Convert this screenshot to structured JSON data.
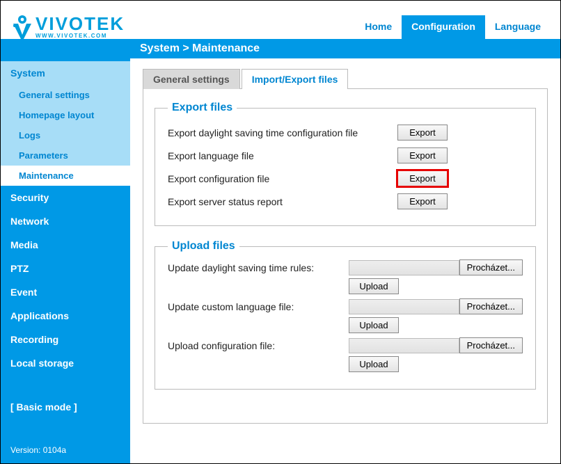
{
  "logo": {
    "text": "VIVOTEK",
    "sub": "WWW.VIVOTEK.COM"
  },
  "topnav": {
    "home": "Home",
    "configuration": "Configuration",
    "language": "Language"
  },
  "breadcrumb": "System  > Maintenance",
  "sidebar": {
    "items": [
      "System",
      "Security",
      "Network",
      "Media",
      "PTZ",
      "Event",
      "Applications",
      "Recording",
      "Local storage"
    ],
    "subitems": [
      "General settings",
      "Homepage layout",
      "Logs",
      "Parameters",
      "Maintenance"
    ],
    "basic_mode": "[ Basic mode ]",
    "version": "Version: 0104a"
  },
  "tabs": {
    "general": "General settings",
    "importexport": "Import/Export files"
  },
  "export_section": {
    "legend": "Export files",
    "rows": [
      {
        "label": "Export daylight saving time configuration file",
        "btn": "Export"
      },
      {
        "label": "Export language file",
        "btn": "Export"
      },
      {
        "label": "Export configuration file",
        "btn": "Export",
        "highlight": true
      },
      {
        "label": "Export server status report",
        "btn": "Export"
      }
    ]
  },
  "upload_section": {
    "legend": "Upload files",
    "rows": [
      {
        "label": "Update daylight saving time rules:",
        "browse": "Procházet...",
        "upload": "Upload"
      },
      {
        "label": "Update custom language file:",
        "browse": "Procházet...",
        "upload": "Upload"
      },
      {
        "label": "Upload configuration file:",
        "browse": "Procházet...",
        "upload": "Upload"
      }
    ]
  }
}
